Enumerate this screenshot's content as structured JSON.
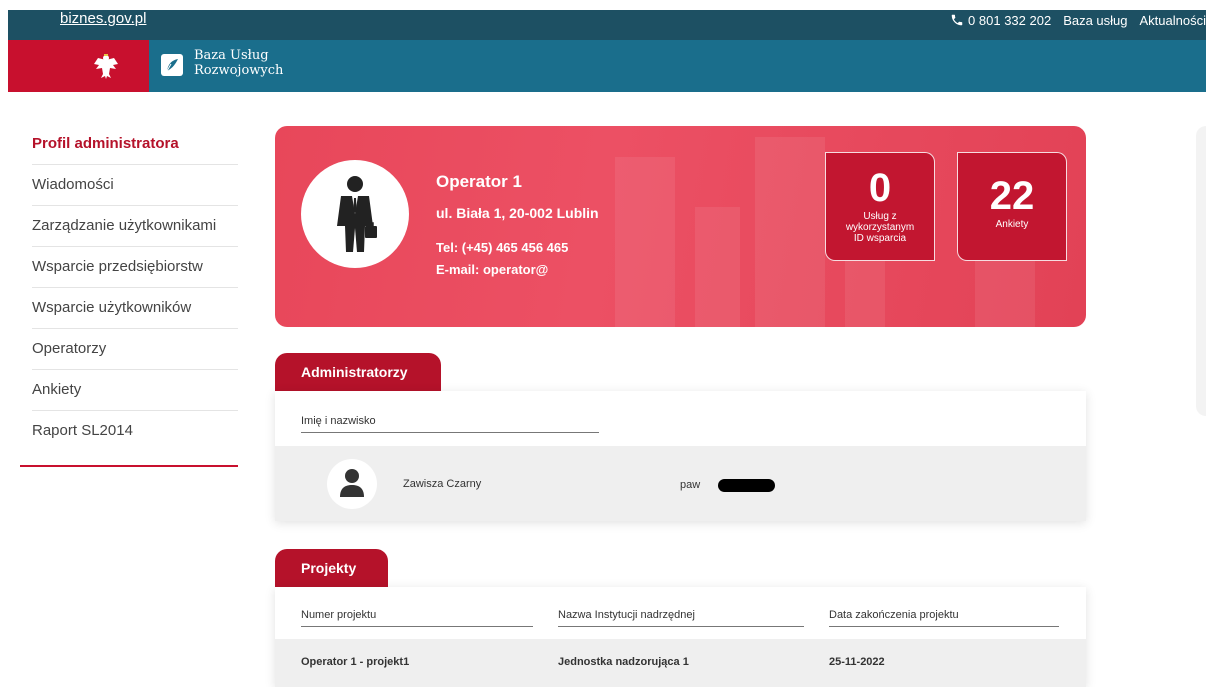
{
  "topbar": {
    "site_link": "biznes.gov.pl",
    "phone": "0 801 332 202",
    "links": [
      "Baza usług",
      "Aktualności"
    ]
  },
  "header": {
    "logo_line1": "Baza Usług",
    "logo_line2": "Rozwojowych"
  },
  "sidebar": {
    "items": [
      {
        "label": "Profil administratora",
        "active": true
      },
      {
        "label": "Wiadomości"
      },
      {
        "label": "Zarządzanie użytkownikami"
      },
      {
        "label": "Wsparcie przedsiębiorstw"
      },
      {
        "label": "Wsparcie użytkowników"
      },
      {
        "label": "Operatorzy"
      },
      {
        "label": "Ankiety"
      },
      {
        "label": "Raport SL2014"
      }
    ]
  },
  "profile": {
    "name": "Operator 1",
    "address": "ul. Biała 1, 20-002 Lublin",
    "tel": "Tel: (+45) 465 456 465",
    "email": "E-mail: operator@",
    "stats": [
      {
        "value": "0",
        "label_lines": [
          "Usług z",
          "wykorzystanym",
          "ID wsparcia"
        ]
      },
      {
        "value": "22",
        "label_lines": [
          "Ankiety"
        ]
      }
    ]
  },
  "admins": {
    "tab_label": "Administratorzy",
    "column_header": "Imię i nazwisko",
    "rows": [
      {
        "name": "Zawisza Czarny",
        "login_prefix": "paw"
      }
    ]
  },
  "projects": {
    "tab_label": "Projekty",
    "columns": [
      "Numer projektu",
      "Nazwa Instytucji nadrzędnej",
      "Data zakończenia projektu"
    ],
    "rows": [
      [
        "Operator 1 - projekt1",
        "Jednostka nadzorująca 1",
        "25-11-2022"
      ]
    ]
  },
  "colors": {
    "brand_red": "#c8102e",
    "header_teal": "#1a6e8c",
    "topbar_dark": "#1d5063",
    "card_pink": "#ec5064"
  }
}
